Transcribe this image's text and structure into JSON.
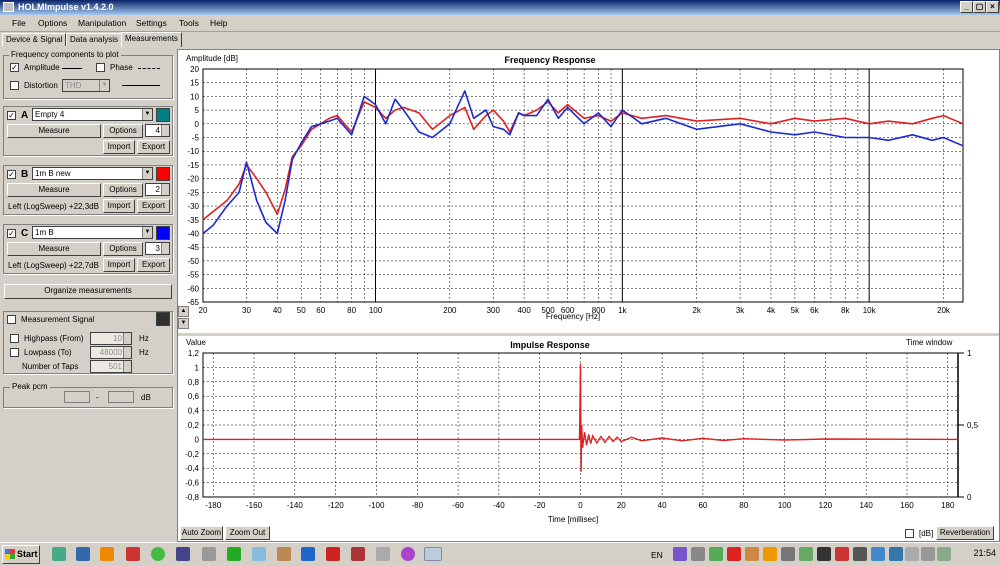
{
  "window": {
    "title": "HOLMImpulse  v1.4.2.0",
    "controls": [
      "_",
      "▢",
      "×"
    ]
  },
  "menu": [
    "File",
    "Options",
    "Manipulation",
    "Settings",
    "Tools",
    "Help"
  ],
  "tabs": [
    "Device & Signal",
    "Data analysis",
    "Measurements"
  ],
  "freq_components": {
    "title": "Frequency components to plot",
    "amplitude": {
      "label": "Amplitude",
      "checked": true
    },
    "phase": {
      "label": "Phase",
      "checked": false
    },
    "distortion": {
      "label": "Distortion",
      "checked": false,
      "value": "THD"
    }
  },
  "measurements": [
    {
      "letter": "A",
      "checked": true,
      "name": "Empty 4",
      "color": "#008080",
      "measure": "Measure",
      "options": "Options",
      "count": "4",
      "info": "",
      "import": "Import",
      "export": "Export"
    },
    {
      "letter": "B",
      "checked": true,
      "name": "1m B new",
      "color": "#ff0000",
      "measure": "Measure",
      "options": "Options",
      "count": "2",
      "info": "Left (LogSweep) +22,3dB",
      "import": "Import",
      "export": "Export"
    },
    {
      "letter": "C",
      "checked": true,
      "name": "1m B",
      "color": "#0000ff",
      "measure": "Measure",
      "options": "Options",
      "count": "3",
      "info": "Left (LogSweep) +22,7dB",
      "import": "Import",
      "export": "Export"
    }
  ],
  "organize_label": "Organize measurements",
  "signal": {
    "label": "Measurement Signal",
    "checked": false,
    "highpass": {
      "label": "Highpass (From)",
      "value": "10",
      "unit": "Hz"
    },
    "lowpass": {
      "label": "Lowpass (To)",
      "value": "48000",
      "unit": "Hz"
    },
    "taps": {
      "label": "Number of Taps",
      "value": "501"
    }
  },
  "peak": {
    "title": "Peak pcm",
    "left": " ",
    "sep": "-",
    "right": " ",
    "unit": "dB"
  },
  "freq_plot": {
    "ylabel": "Amplitude [dB]",
    "title": "Frequency Response",
    "xlabel": "Frequency [Hz]"
  },
  "imp_plot": {
    "ylabel": "Value",
    "title": "Impulse Response",
    "xlabel": "Time [millisec]",
    "right_label": "Time window"
  },
  "bottom": {
    "auto_zoom": "Auto Zoom",
    "zoom_out": "Zoom Out",
    "db_label": "[dB]",
    "reverberation": "Reverberation"
  },
  "taskbar": {
    "start": "Start",
    "lang": "EN",
    "clock": "21:54"
  },
  "chart_data": [
    {
      "type": "line",
      "title": "Frequency Response",
      "xlabel": "Frequency [Hz]",
      "ylabel": "Amplitude [dB]",
      "xscale": "log",
      "xlim": [
        20,
        24000
      ],
      "ylim": [
        -65,
        20
      ],
      "xticks": [
        20,
        30,
        40,
        50,
        60,
        80,
        100,
        200,
        300,
        400,
        500,
        600,
        800,
        1000,
        2000,
        3000,
        4000,
        5000,
        6000,
        8000,
        10000,
        20000
      ],
      "xticklabels": [
        "20",
        "30",
        "40",
        "50",
        "60",
        "80",
        "100",
        "200",
        "300",
        "400",
        "500",
        "600",
        "800",
        "1k",
        "2k",
        "3k",
        "4k",
        "5k",
        "6k",
        "8k",
        "10k",
        "20k"
      ],
      "yticks": [
        20,
        15,
        10,
        5,
        0,
        -5,
        -10,
        -15,
        -20,
        -25,
        -30,
        -35,
        -40,
        -45,
        -50,
        -55,
        -60,
        -65
      ],
      "grid": true,
      "series": [
        {
          "color": "#e02020",
          "x": [
            20,
            22,
            25,
            28,
            30,
            33,
            36,
            40,
            43,
            46,
            50,
            55,
            60,
            65,
            70,
            80,
            90,
            100,
            110,
            120,
            130,
            150,
            170,
            200,
            230,
            250,
            280,
            300,
            330,
            350,
            380,
            400,
            450,
            500,
            550,
            600,
            700,
            800,
            900,
            1000,
            1200,
            1500,
            2000,
            3000,
            4000,
            5000,
            6000,
            8000,
            10000,
            12000,
            15000,
            18000,
            20000,
            24000
          ],
          "y": [
            -35,
            -32,
            -28,
            -22,
            -15,
            -20,
            -25,
            -33,
            -24,
            -12,
            -8,
            -2,
            0,
            2,
            3,
            -3,
            8,
            6,
            2,
            5,
            6,
            4,
            -2,
            3,
            6,
            -2,
            3,
            5,
            1,
            -3,
            4,
            3,
            5,
            8,
            4,
            7,
            2,
            3,
            1,
            4,
            2,
            3,
            1,
            2,
            0,
            2,
            1,
            2,
            0,
            1,
            0,
            2,
            3,
            0
          ]
        },
        {
          "color": "#1a2ad0",
          "x": [
            20,
            22,
            25,
            28,
            30,
            33,
            36,
            40,
            43,
            46,
            50,
            55,
            60,
            65,
            70,
            80,
            90,
            100,
            110,
            120,
            130,
            150,
            170,
            200,
            230,
            250,
            280,
            300,
            330,
            350,
            380,
            400,
            450,
            500,
            550,
            600,
            700,
            800,
            900,
            1000,
            1200,
            1500,
            2000,
            3000,
            4000,
            5000,
            6000,
            8000,
            10000,
            12000,
            15000,
            18000,
            20000,
            24000
          ],
          "y": [
            -40,
            -37,
            -30,
            -25,
            -14,
            -28,
            -36,
            -40,
            -28,
            -13,
            -7,
            -1,
            0,
            1,
            2,
            -4,
            10,
            7,
            0,
            9,
            5,
            -3,
            -5,
            0,
            12,
            2,
            5,
            -1,
            -2,
            -4,
            4,
            3,
            3,
            9,
            2,
            6,
            0,
            4,
            -1,
            5,
            0,
            2,
            -2,
            0,
            -3,
            -4,
            -3,
            -5,
            -5,
            -6,
            -4,
            -6,
            -5,
            -8
          ]
        }
      ]
    },
    {
      "type": "line",
      "title": "Impulse Response",
      "xlabel": "Time [millisec]",
      "ylabel": "Value",
      "xlim": [
        -185,
        185
      ],
      "ylim": [
        -0.8,
        1.2
      ],
      "xticks": [
        -180,
        -160,
        -140,
        -120,
        -100,
        -80,
        -60,
        -40,
        -20,
        0,
        20,
        40,
        60,
        80,
        100,
        120,
        140,
        160,
        180
      ],
      "yticks": [
        1.2,
        1,
        0.8,
        0.6,
        0.4,
        0.2,
        0,
        -0.2,
        -0.4,
        -0.6,
        -0.8
      ],
      "yticklabels": [
        "1,2",
        "1",
        "0,8",
        "0,6",
        "0,4",
        "0,2",
        "0",
        "-0,2",
        "-0,4",
        "-0,6",
        "-0,8"
      ],
      "right_yticks": [
        "1",
        "0,5",
        "0"
      ],
      "grid": true,
      "series": [
        {
          "color": "#e02020",
          "x": [
            -185,
            -0.5,
            0,
            0.3,
            0.6,
            1,
            2,
            3,
            4,
            5,
            6,
            8,
            10,
            12,
            14,
            16,
            18,
            20,
            25,
            30,
            40,
            50,
            60,
            70,
            80,
            100,
            120,
            185
          ],
          "y": [
            0,
            0,
            1.05,
            -0.45,
            0.2,
            -0.12,
            0.1,
            -0.08,
            0.07,
            -0.06,
            0.05,
            -0.05,
            0.04,
            -0.04,
            0.04,
            -0.03,
            0.03,
            -0.03,
            0.03,
            -0.02,
            0.02,
            -0.02,
            0.015,
            -0.015,
            0.01,
            -0.01,
            0.005,
            0
          ]
        }
      ]
    }
  ]
}
